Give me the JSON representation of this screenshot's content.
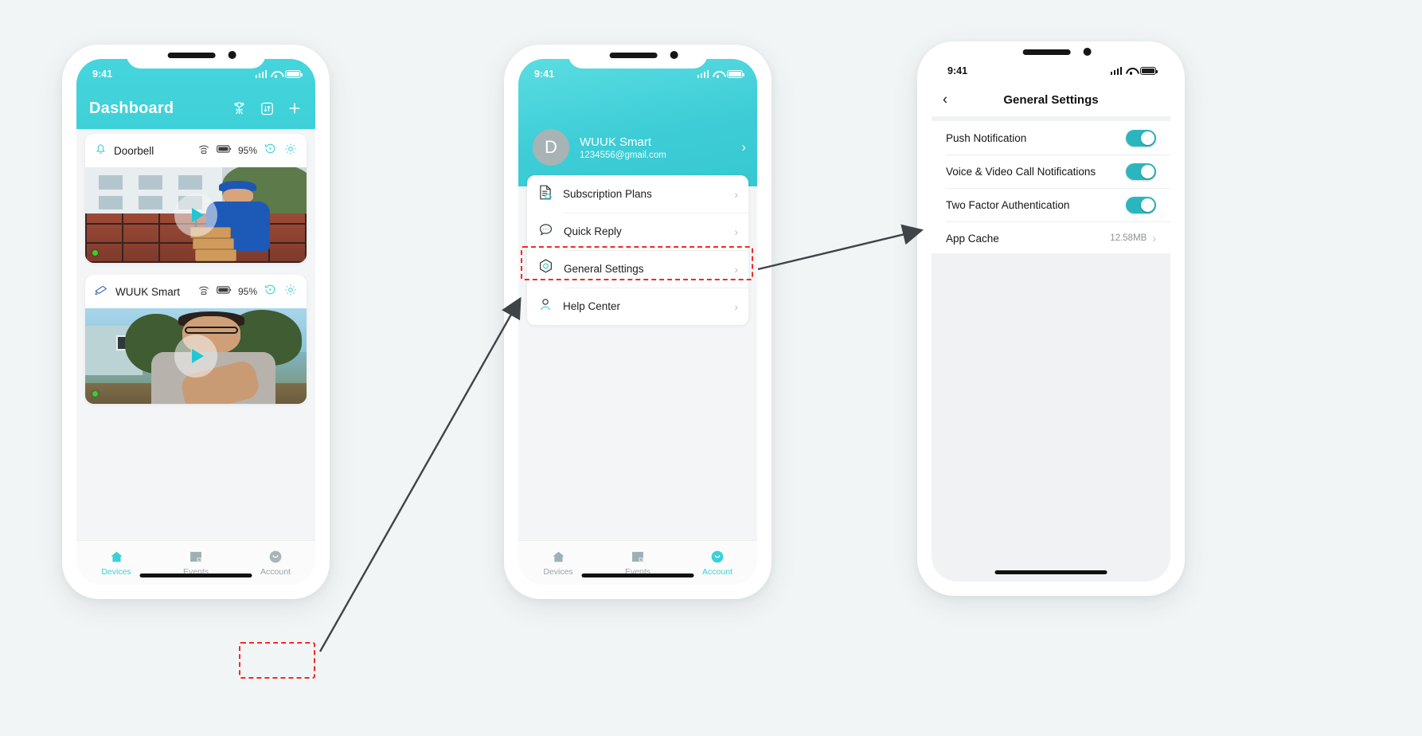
{
  "canvas": {
    "background": "#f2f5f6",
    "accent": "#3dcfd8",
    "highlight": "#f42a21"
  },
  "phone1": {
    "status": {
      "time": "9:41"
    },
    "header": {
      "title": "Dashboard",
      "actions": [
        {
          "name": "family-sharing-icon",
          "label": "Family Sharing"
        },
        {
          "name": "sort-icon",
          "label": "Sort"
        },
        {
          "name": "add-icon",
          "label": "Add Device"
        }
      ]
    },
    "devices": [
      {
        "name": "Doorbell",
        "type_icon": "doorbell-icon",
        "battery": "95%",
        "wifi_icon": "wifi-router-icon",
        "battery_icon": "battery-icon",
        "history_icon": "history-icon",
        "settings_icon": "gear-icon",
        "status_led": "online"
      },
      {
        "name": "WUUK Smart",
        "type_icon": "camera-icon",
        "battery": "95%",
        "wifi_icon": "wifi-router-icon",
        "battery_icon": "battery-icon",
        "history_icon": "history-icon",
        "settings_icon": "gear-icon",
        "status_led": "online"
      }
    ],
    "tabs": [
      {
        "label": "Devices",
        "icon": "home-icon",
        "active": true
      },
      {
        "label": "Events",
        "icon": "events-icon",
        "active": false
      },
      {
        "label": "Account",
        "icon": "account-icon",
        "active": false
      }
    ]
  },
  "phone2": {
    "status": {
      "time": "9:41"
    },
    "account": {
      "avatar_initial": "D",
      "name": "WUUK Smart",
      "email": "1234556@gmail.com",
      "chevron": "›"
    },
    "menu": [
      {
        "label": "Subscription Plans",
        "icon": "subscription-icon",
        "chevron": "›"
      },
      {
        "label": "Quick Reply",
        "icon": "chat-icon",
        "chevron": "›"
      },
      {
        "label": "General Settings",
        "icon": "settings-hex-icon",
        "chevron": "›",
        "highlighted": true
      },
      {
        "label": "Help Center",
        "icon": "person-icon",
        "chevron": "›"
      }
    ],
    "tabs": [
      {
        "label": "Devices",
        "icon": "home-icon",
        "active": false
      },
      {
        "label": "Events",
        "icon": "events-icon",
        "active": false
      },
      {
        "label": "Account",
        "icon": "account-icon",
        "active": true
      }
    ]
  },
  "phone3": {
    "status": {
      "time": "9:41"
    },
    "header": {
      "title": "General Settings",
      "back": "‹"
    },
    "rows": [
      {
        "label": "Push Notification",
        "control": "toggle",
        "value": "on"
      },
      {
        "label": "Voice & Video Call Notifications",
        "control": "toggle",
        "value": "on"
      },
      {
        "label": "Two Factor Authentication",
        "control": "toggle",
        "value": "on"
      },
      {
        "label": "App Cache",
        "control": "value",
        "value": "12.58MB",
        "chevron": "›"
      }
    ]
  }
}
